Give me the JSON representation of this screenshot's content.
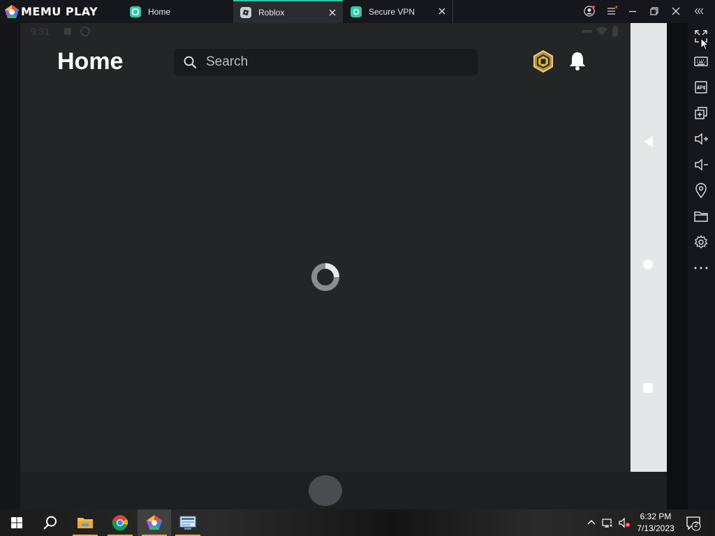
{
  "app": {
    "brand": "MEMU PLAY"
  },
  "tabs": [
    {
      "label": "Home",
      "active": false,
      "closable": false,
      "icon": "memu-home-icon"
    },
    {
      "label": "Roblox",
      "active": true,
      "closable": true,
      "icon": "roblox-icon"
    },
    {
      "label": "Secure VPN",
      "active": false,
      "closable": true,
      "icon": "vpn-icon"
    }
  ],
  "status_bar": {
    "time": "9:31"
  },
  "roblox": {
    "page_title": "Home",
    "search_placeholder": "Search"
  },
  "side_toolbar": [
    "fullscreen-icon",
    "keyboard-icon",
    "apk-icon",
    "multi-instance-icon",
    "volume-up-icon",
    "volume-down-icon",
    "location-icon",
    "folder-icon",
    "settings-icon",
    "more-icon"
  ],
  "taskbar": {
    "time": "6:32 PM",
    "date": "7/13/2023",
    "notification_count": "2"
  },
  "colors": {
    "accent": "#2fc9a6",
    "screen_bg": "#232527",
    "navbar_bg": "#e5e6e7"
  }
}
